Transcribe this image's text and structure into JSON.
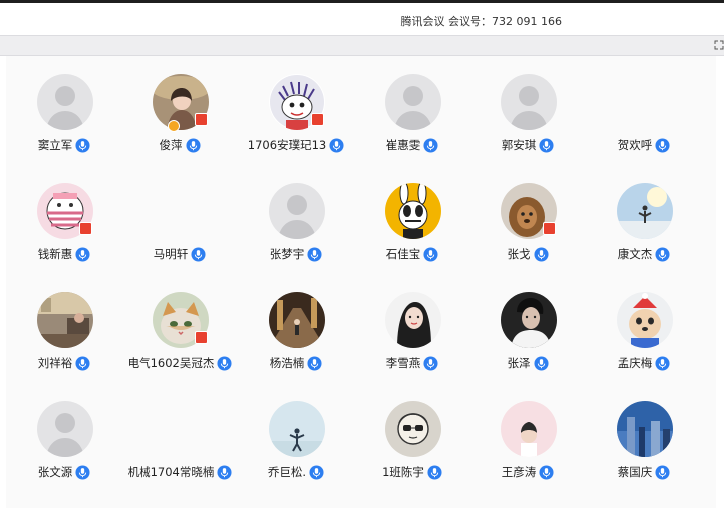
{
  "header": {
    "meeting_info": "腾讯会议 会议号：732 091 166"
  },
  "participants": [
    {
      "name": "窦立军",
      "avatar": "default"
    },
    {
      "name": "俊萍",
      "avatar": "photo-woman-hat"
    },
    {
      "name": "1706安璞玘13",
      "avatar": "cartoon-kid"
    },
    {
      "name": "崔惠雯",
      "avatar": "default"
    },
    {
      "name": "郭安琪",
      "avatar": "default"
    },
    {
      "name": "贺欢呼",
      "avatar": "none"
    },
    {
      "name": "钱新惠",
      "avatar": "cartoon-pink"
    },
    {
      "name": "马明轩",
      "avatar": "none"
    },
    {
      "name": "张梦宇",
      "avatar": "default"
    },
    {
      "name": "石佳宝",
      "avatar": "cartoon-rabbit"
    },
    {
      "name": "张戈",
      "avatar": "photo-lion"
    },
    {
      "name": "康文杰",
      "avatar": "photo-sky-person"
    },
    {
      "name": "刘祥裕",
      "avatar": "photo-room"
    },
    {
      "name": "电气1602吴冠杰",
      "avatar": "photo-cat"
    },
    {
      "name": "杨浩楠",
      "avatar": "photo-street"
    },
    {
      "name": "李雪燕",
      "avatar": "photo-girl"
    },
    {
      "name": "张泽",
      "avatar": "photo-man-dark"
    },
    {
      "name": "孟庆梅",
      "avatar": "photo-dog-hat"
    },
    {
      "name": "张文源",
      "avatar": "default"
    },
    {
      "name": "机械1704常晓楠",
      "avatar": "none"
    },
    {
      "name": "乔巨松.",
      "avatar": "photo-fog-person"
    },
    {
      "name": "1班陈宇",
      "avatar": "sketch-glasses"
    },
    {
      "name": "王彦涛",
      "avatar": "photo-pink-child"
    },
    {
      "name": "蔡国庆",
      "avatar": "photo-city"
    }
  ]
}
